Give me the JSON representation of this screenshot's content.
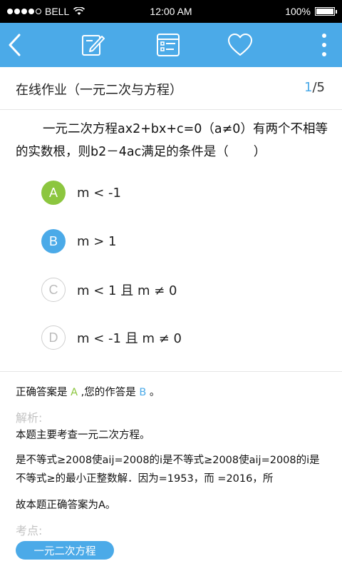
{
  "status_bar": {
    "carrier": "BELL",
    "time": "12:00 AM",
    "battery": "100%",
    "battery_level": 1.0
  },
  "toolbar": {
    "icons": [
      "back-chevron-icon",
      "edit-note-icon",
      "list-sheet-icon",
      "heart-icon",
      "more-vertical-icon"
    ],
    "background": "#4baae8"
  },
  "header": {
    "title": "在线作业（一元二次与方程）",
    "current_page": "1",
    "total_pages": "/5"
  },
  "question": {
    "text": "一元二次方程ax2+bx+c=0（a≠0）有两个不相等的实数根，则b2－4ac满足的条件是（　　）"
  },
  "options": [
    {
      "letter": "A",
      "text": "m < -1",
      "state": "correct"
    },
    {
      "letter": "B",
      "text": "m > 1",
      "state": "selected"
    },
    {
      "letter": "C",
      "text": "m < 1 且 m ≠ 0",
      "state": "normal"
    },
    {
      "letter": "D",
      "text": "m < -1 且 m ≠ 0",
      "state": "normal"
    }
  ],
  "answer": {
    "prefix": "正确答案是",
    "correct": "A",
    "middle": ",您的作答是",
    "mine": "B",
    "suffix": "。"
  },
  "analysis": {
    "label": "解析:",
    "line1": "本题主要考查一元二次方程。",
    "line2": "是不等式≥2008使aij=2008的i是不等式≥2008使aij=2008的i是不等式≥的最小正整数解．因为=1953，而 =2016，所",
    "line3": "故本题正确答案为A。"
  },
  "knowledge": {
    "label": "考点:",
    "tag": "一元二次方程"
  },
  "colors": {
    "accent": "#4baae8",
    "correct": "#8cc63f"
  }
}
